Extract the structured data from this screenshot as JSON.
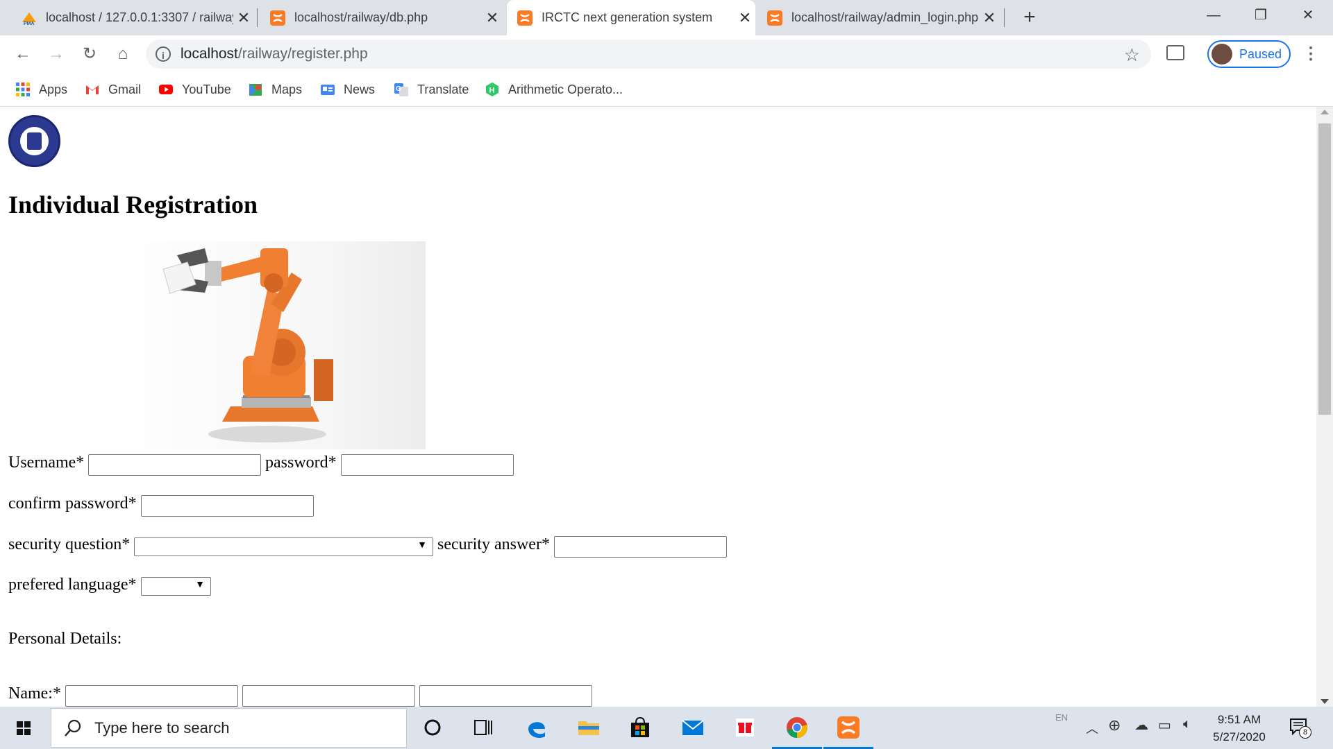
{
  "browser": {
    "tabs": [
      {
        "title": "localhost / 127.0.0.1:3307 / railway",
        "active": false,
        "favicon": "phpmyadmin-icon"
      },
      {
        "title": "localhost/railway/db.php",
        "active": false,
        "favicon": "xampp-icon"
      },
      {
        "title": "IRCTC next generation system",
        "active": true,
        "favicon": "xampp-icon"
      },
      {
        "title": "localhost/railway/admin_login.php",
        "active": false,
        "favicon": "xampp-icon"
      }
    ],
    "new_tab": "+",
    "url_host": "localhost",
    "url_path": "/railway/register.php",
    "profile_label": "Paused",
    "bookmarks": [
      {
        "label": "Apps",
        "icon": "apps-grid-icon"
      },
      {
        "label": "Gmail",
        "icon": "gmail-icon"
      },
      {
        "label": "YouTube",
        "icon": "youtube-icon"
      },
      {
        "label": "Maps",
        "icon": "maps-icon"
      },
      {
        "label": "News",
        "icon": "news-icon"
      },
      {
        "label": "Translate",
        "icon": "translate-icon"
      },
      {
        "label": "Arithmetic Operato...",
        "icon": "hackerrank-icon"
      }
    ]
  },
  "page": {
    "heading": "Individual Registration",
    "form": {
      "username_label": "Username*",
      "username_value": "",
      "password_label": "password*",
      "password_value": "",
      "confirm_password_label": "confirm password*",
      "confirm_password_value": "",
      "security_question_label": "security question*",
      "security_question_value": "",
      "security_answer_label": "security answer*",
      "security_answer_value": "",
      "language_label": "prefered language*",
      "language_value": "",
      "personal_details_label": "Personal Details:",
      "name_label": "Name:*",
      "name_first": "",
      "name_middle": "",
      "name_last": ""
    }
  },
  "taskbar": {
    "search_placeholder": "Type here to search",
    "language_indicator": "EN",
    "time": "9:51 AM",
    "date": "5/27/2020",
    "notification_count": "8"
  },
  "colors": {
    "accent": "#1a73e8",
    "xampp_orange": "#fb7a24",
    "tabstrip": "#dee1e6",
    "taskbar": "#dde3ec"
  }
}
